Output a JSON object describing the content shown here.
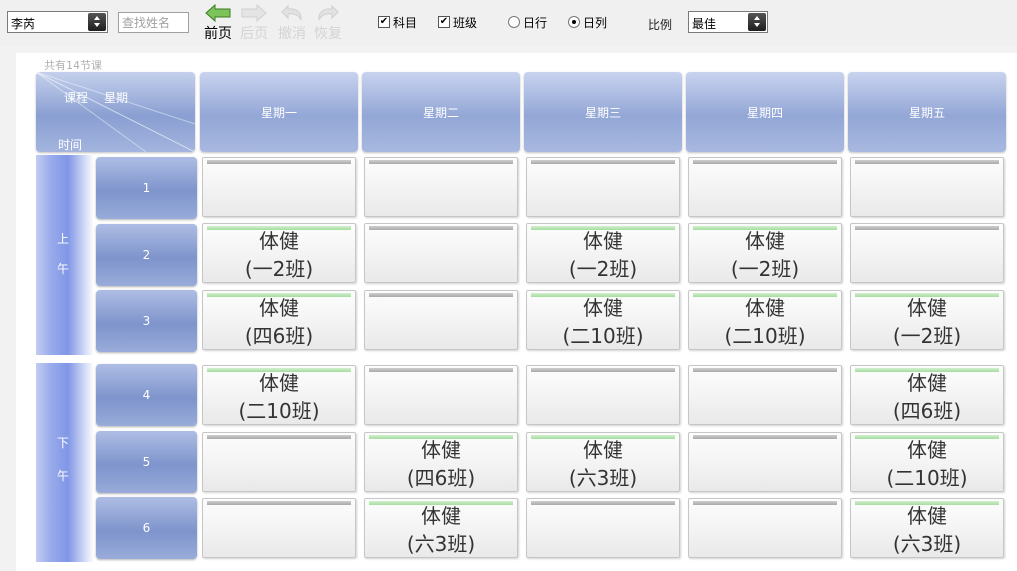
{
  "toolbar": {
    "user_select": "李芮",
    "search_placeholder": "查找姓名",
    "prev_label": "前页",
    "next_label": "后页",
    "undo_label": "撤消",
    "redo_label": "恢复",
    "checkbox_subject": {
      "label": "科目",
      "checked": true
    },
    "checkbox_class": {
      "label": "班级",
      "checked": true
    },
    "radio_dayrow": {
      "label": "日行",
      "selected": false
    },
    "radio_daycol": {
      "label": "日列",
      "selected": true
    },
    "ratio_label": "比例",
    "ratio_select": "最佳"
  },
  "timetable": {
    "lesson_count": "共有14节课",
    "corner": {
      "course": "课程",
      "weekday": "星期",
      "time": "时间"
    },
    "days": [
      "星期一",
      "星期二",
      "星期三",
      "星期四",
      "星期五"
    ],
    "halfdays": [
      {
        "label": "上午"
      },
      {
        "label": "下午"
      }
    ],
    "periods": [
      "1",
      "2",
      "3",
      "4",
      "5",
      "6"
    ],
    "cells": [
      [
        null,
        null,
        null,
        null,
        null
      ],
      [
        {
          "subject": "体健",
          "klass": "(一2班)"
        },
        null,
        {
          "subject": "体健",
          "klass": "(一2班)"
        },
        {
          "subject": "体健",
          "klass": "(一2班)"
        },
        null
      ],
      [
        {
          "subject": "体健",
          "klass": "(四6班)"
        },
        null,
        {
          "subject": "体健",
          "klass": "(二10班)"
        },
        {
          "subject": "体健",
          "klass": "(二10班)"
        },
        {
          "subject": "体健",
          "klass": "(一2班)"
        }
      ],
      [
        {
          "subject": "体健",
          "klass": "(二10班)"
        },
        null,
        null,
        null,
        {
          "subject": "体健",
          "klass": "(四6班)"
        }
      ],
      [
        null,
        {
          "subject": "体健",
          "klass": "(四6班)"
        },
        {
          "subject": "体健",
          "klass": "(六3班)"
        },
        null,
        {
          "subject": "体健",
          "klass": "(二10班)"
        }
      ],
      [
        null,
        {
          "subject": "体健",
          "klass": "(六3班)"
        },
        null,
        null,
        {
          "subject": "体健",
          "klass": "(六3班)"
        }
      ]
    ]
  },
  "colors": {
    "header_blue": "#93a7d6",
    "period_blue": "#7e94cc",
    "filled_bar": "#a4dd9f",
    "empty_bar": "#a9a9a9",
    "prev_arrow": "#5aa03a"
  }
}
